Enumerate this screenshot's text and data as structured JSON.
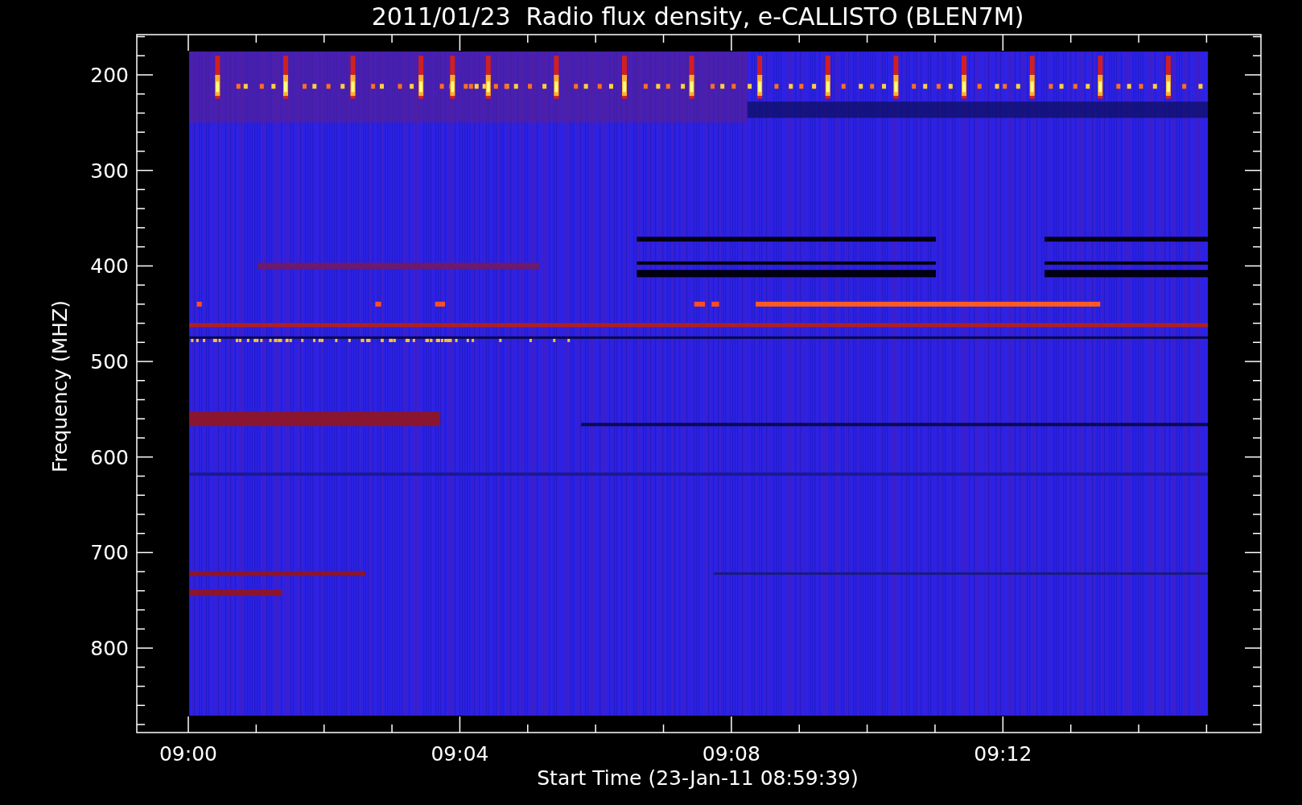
{
  "title": "2011/01/23  Radio flux density, e-CALLISTO (BLEN7M)",
  "y_axis": {
    "label": "Frequency (MHZ)",
    "ticks": [
      "200",
      "300",
      "400",
      "500",
      "600",
      "700",
      "800"
    ]
  },
  "x_axis": {
    "label": "Start Time (23-Jan-11 08:59:39)",
    "ticks": [
      "09:00",
      "09:04",
      "09:08",
      "09:12"
    ]
  }
}
